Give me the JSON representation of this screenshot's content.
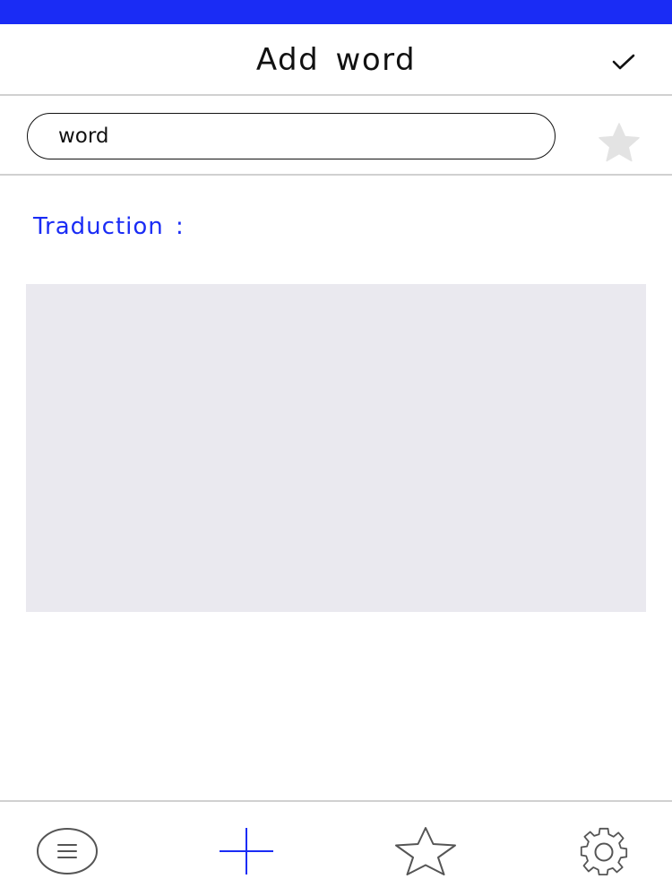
{
  "header": {
    "title": "Add  word",
    "confirm_icon": "checkmark-icon"
  },
  "search": {
    "value": "word",
    "favorite_icon": "star-filled-icon"
  },
  "translation": {
    "label": "Traduction  :"
  },
  "tab_bar": {
    "tabs": [
      {
        "icon": "list-icon"
      },
      {
        "icon": "plus-icon"
      },
      {
        "icon": "star-outline-icon"
      },
      {
        "icon": "gear-icon"
      }
    ]
  },
  "colors": {
    "accent": "#1a2cf5",
    "translation_background": "#eae9ef",
    "divider": "#d0d0d0",
    "favorite_star": "#e3e3e3"
  }
}
